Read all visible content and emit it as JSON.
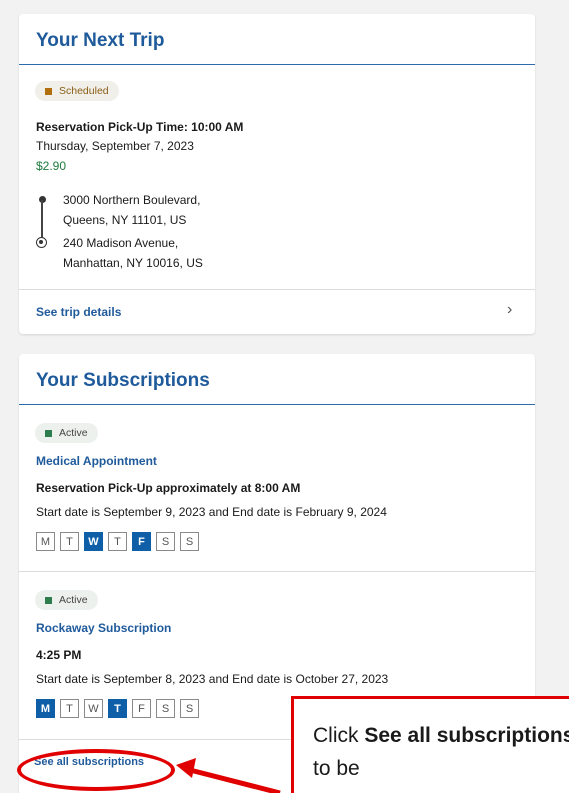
{
  "next_trip": {
    "title": "Your Next Trip",
    "status": "Scheduled",
    "pickup_time": "Reservation Pick-Up Time: 10:00 AM",
    "date": "Thursday, September 7, 2023",
    "fare": "$2.90",
    "origin_line1": "3000 Northern Boulevard,",
    "origin_line2": "Queens, NY 11101, US",
    "destination_line1": "240 Madison Avenue,",
    "destination_line2": "Manhattan, NY 10016, US",
    "details_link": "See trip details"
  },
  "subscriptions": {
    "title": "Your Subscriptions",
    "items": [
      {
        "status": "Active",
        "name": "Medical Appointment",
        "pickup": "Reservation Pick-Up approximately at 8:00 AM",
        "dates": "Start date is September 9, 2023 and End date is February 9, 2024",
        "days": [
          "M",
          "T",
          "W",
          "T",
          "F",
          "S",
          "S"
        ],
        "active_days": [
          false,
          false,
          true,
          false,
          true,
          false,
          false
        ]
      },
      {
        "status": "Active",
        "name": "Rockaway Subscription",
        "pickup": "4:25 PM",
        "dates": "Start date is September 8, 2023 and End date is October 27, 2023",
        "days": [
          "M",
          "T",
          "W",
          "T",
          "F",
          "S",
          "S"
        ],
        "active_days": [
          true,
          false,
          false,
          true,
          false,
          false,
          false
        ]
      }
    ],
    "see_all_link": "See all subscriptions"
  },
  "annotation": {
    "prefix": "Click ",
    "bold": "See all subscriptions",
    "suffix": " to be",
    "color": "#e00000"
  }
}
